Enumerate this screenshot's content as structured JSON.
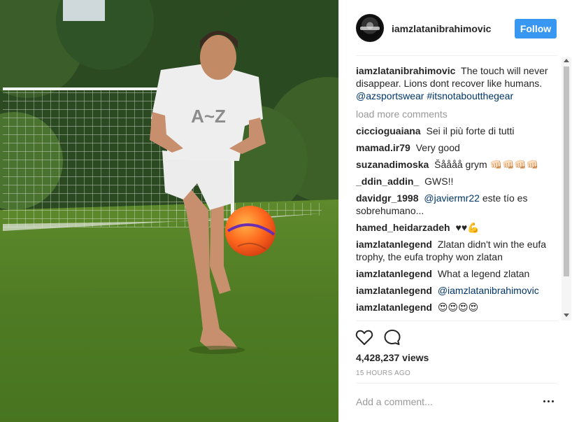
{
  "post": {
    "username": "iamzlatanibrahimovic",
    "follow_label": "Follow",
    "caption": {
      "user": "iamzlatanibrahimovic",
      "text": "The touch will never disappear. Lions dont recover like humans.",
      "tags": "@azsportswear #itsnotaboutthegear"
    },
    "load_more": "load more comments",
    "shirt_text": "A~Z"
  },
  "comments": [
    {
      "user": "ciccioguaiana",
      "text": "Sei il più forte di tutti",
      "tag": ""
    },
    {
      "user": "mamad.ir79",
      "text": "Very good",
      "tag": ""
    },
    {
      "user": "suzanadimoska",
      "text": "Šåååå grym 👊🏻👊🏻👊🏻👊🏻",
      "tag": ""
    },
    {
      "user": "_ddin_addin_",
      "text": "GWS!!",
      "tag": ""
    },
    {
      "user": "davidgr_1998",
      "text": "este tío es sobrehumano...",
      "tag": "@javiermr22"
    },
    {
      "user": "hamed_heidarzadeh",
      "text": "♥♥💪",
      "tag": ""
    },
    {
      "user": "iamzlatanlegend",
      "text": "Zlatan didn't win the eufa trophy, the eufa trophy won zlatan",
      "tag": ""
    },
    {
      "user": "iamzlatanlegend",
      "text": "What a legend zlatan",
      "tag": ""
    },
    {
      "user": "iamzlatanlegend",
      "text": "",
      "tag": "@iamzlatanibrahimovic"
    },
    {
      "user": "iamzlatanlegend",
      "text": "😍😍😍😍",
      "tag": ""
    }
  ],
  "stats": {
    "views": "4,428,237 views",
    "time_ago": "15 HOURS AGO"
  },
  "composer": {
    "placeholder": "Add a comment..."
  },
  "icons": {
    "like": "heart-icon",
    "comment": "speech-bubble-icon",
    "more": "ellipsis-icon"
  },
  "colors": {
    "follow_button": "#3897f0",
    "tag_link": "#003569",
    "muted_text": "#999999"
  }
}
